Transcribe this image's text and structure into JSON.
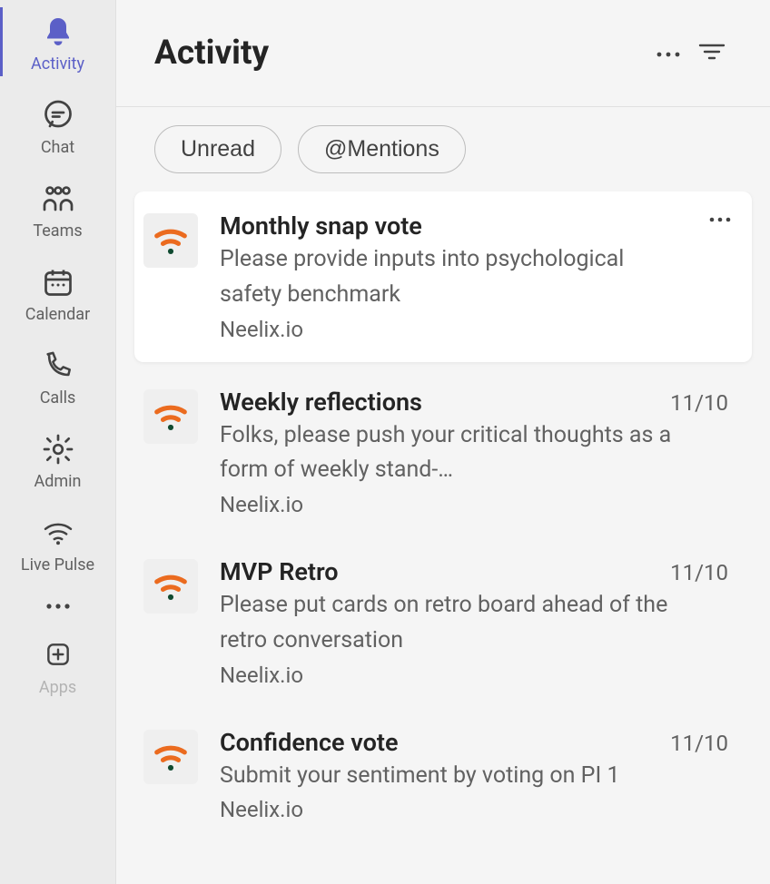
{
  "rail": {
    "items": [
      {
        "id": "activity",
        "label": "Activity",
        "active": true
      },
      {
        "id": "chat",
        "label": "Chat"
      },
      {
        "id": "teams",
        "label": "Teams"
      },
      {
        "id": "calendar",
        "label": "Calendar"
      },
      {
        "id": "calls",
        "label": "Calls"
      },
      {
        "id": "admin",
        "label": "Admin"
      },
      {
        "id": "livepulse",
        "label": "Live Pulse"
      }
    ],
    "apps_label": "Apps"
  },
  "header": {
    "title": "Activity"
  },
  "filters": {
    "unread": "Unread",
    "mentions": "@Mentions"
  },
  "feed": [
    {
      "title": "Monthly snap vote",
      "desc": "Please provide inputs into psychological safety benchmark",
      "source": "Neelix.io",
      "date": "",
      "selected": true
    },
    {
      "title": "Weekly reflections",
      "desc": "Folks, please push your critical thoughts as a form of weekly stand-…",
      "source": "Neelix.io",
      "date": "11/10"
    },
    {
      "title": "MVP Retro",
      "desc": "Please put cards on retro board ahead of the retro conversation",
      "source": "Neelix.io",
      "date": "11/10"
    },
    {
      "title": "Confidence vote",
      "desc": "Submit your sentiment by voting on PI 1",
      "source": "Neelix.io",
      "date": "11/10"
    }
  ]
}
